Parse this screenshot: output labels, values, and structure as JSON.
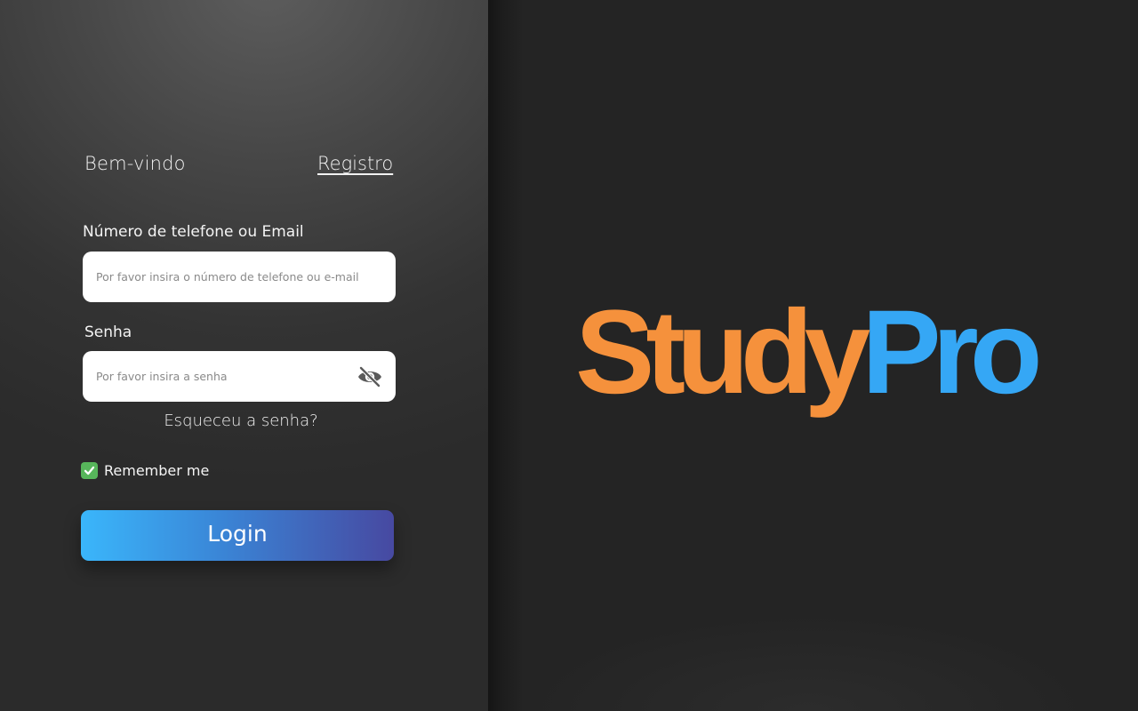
{
  "login": {
    "welcome": "Bem-vindo",
    "register_link": "Registro",
    "email_label": "Número de telefone ou Email",
    "email_placeholder": "Por favor insira o número de telefone ou e-mail",
    "password_label": "Senha",
    "password_placeholder": "Por favor insira a senha",
    "forgot_password": "Esqueceu a senha?",
    "remember_me": "Remember me",
    "remember_checked": true,
    "login_button": "Login"
  },
  "brand": {
    "part1": "Study",
    "part2": "Pro",
    "part1_color": "#f5913c",
    "part2_color": "#35a7f5"
  },
  "icons": {
    "password_toggle": "eye-slash-icon",
    "remember_check": "checkmark-icon"
  }
}
